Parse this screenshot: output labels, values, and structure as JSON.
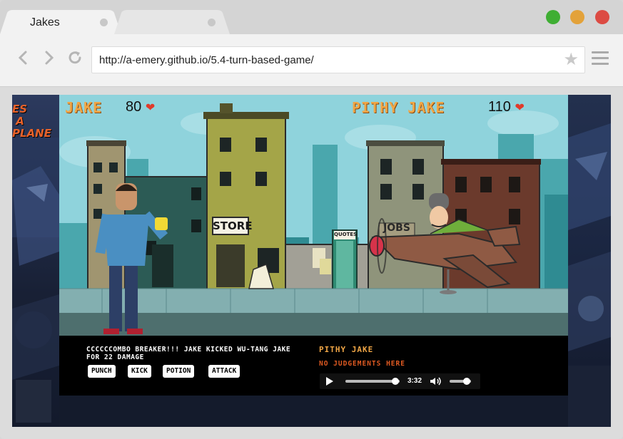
{
  "browser": {
    "tabs": [
      {
        "label": "Jakes",
        "active": true
      },
      {
        "label": "",
        "active": false
      }
    ],
    "url": "http://a-emery.github.io/5.4-turn-based-game/",
    "window_buttons": {
      "green": "#3fae33",
      "yellow": "#e3a23a",
      "red": "#dc4b43"
    }
  },
  "game": {
    "player": {
      "name": "JAKE",
      "hp": "80",
      "heart": "heart-icon"
    },
    "opponent": {
      "name": "PITHY JAKE",
      "hp": "110",
      "heart": "heart-icon"
    },
    "signs": {
      "store": "STORE",
      "jobs": "JOBS",
      "quotes": "QUOTES"
    },
    "battle_message": "CCCCCCOMBO BREAKER!!! JAKE KICKED WU-TANG JAKE FOR 22 DAMAGE",
    "actions": [
      "PUNCH",
      "KICK",
      "POTION",
      "ATTACK"
    ],
    "opponent_panel": {
      "name": "PITHY JAKE",
      "quote": "NO JUDGEMENTS HERE"
    },
    "audio": {
      "time": "3:32",
      "progress": 0.92,
      "volume": 0.8
    }
  },
  "colors": {
    "hud_orange": "#f0a646",
    "sky": "#8fd3dc"
  }
}
